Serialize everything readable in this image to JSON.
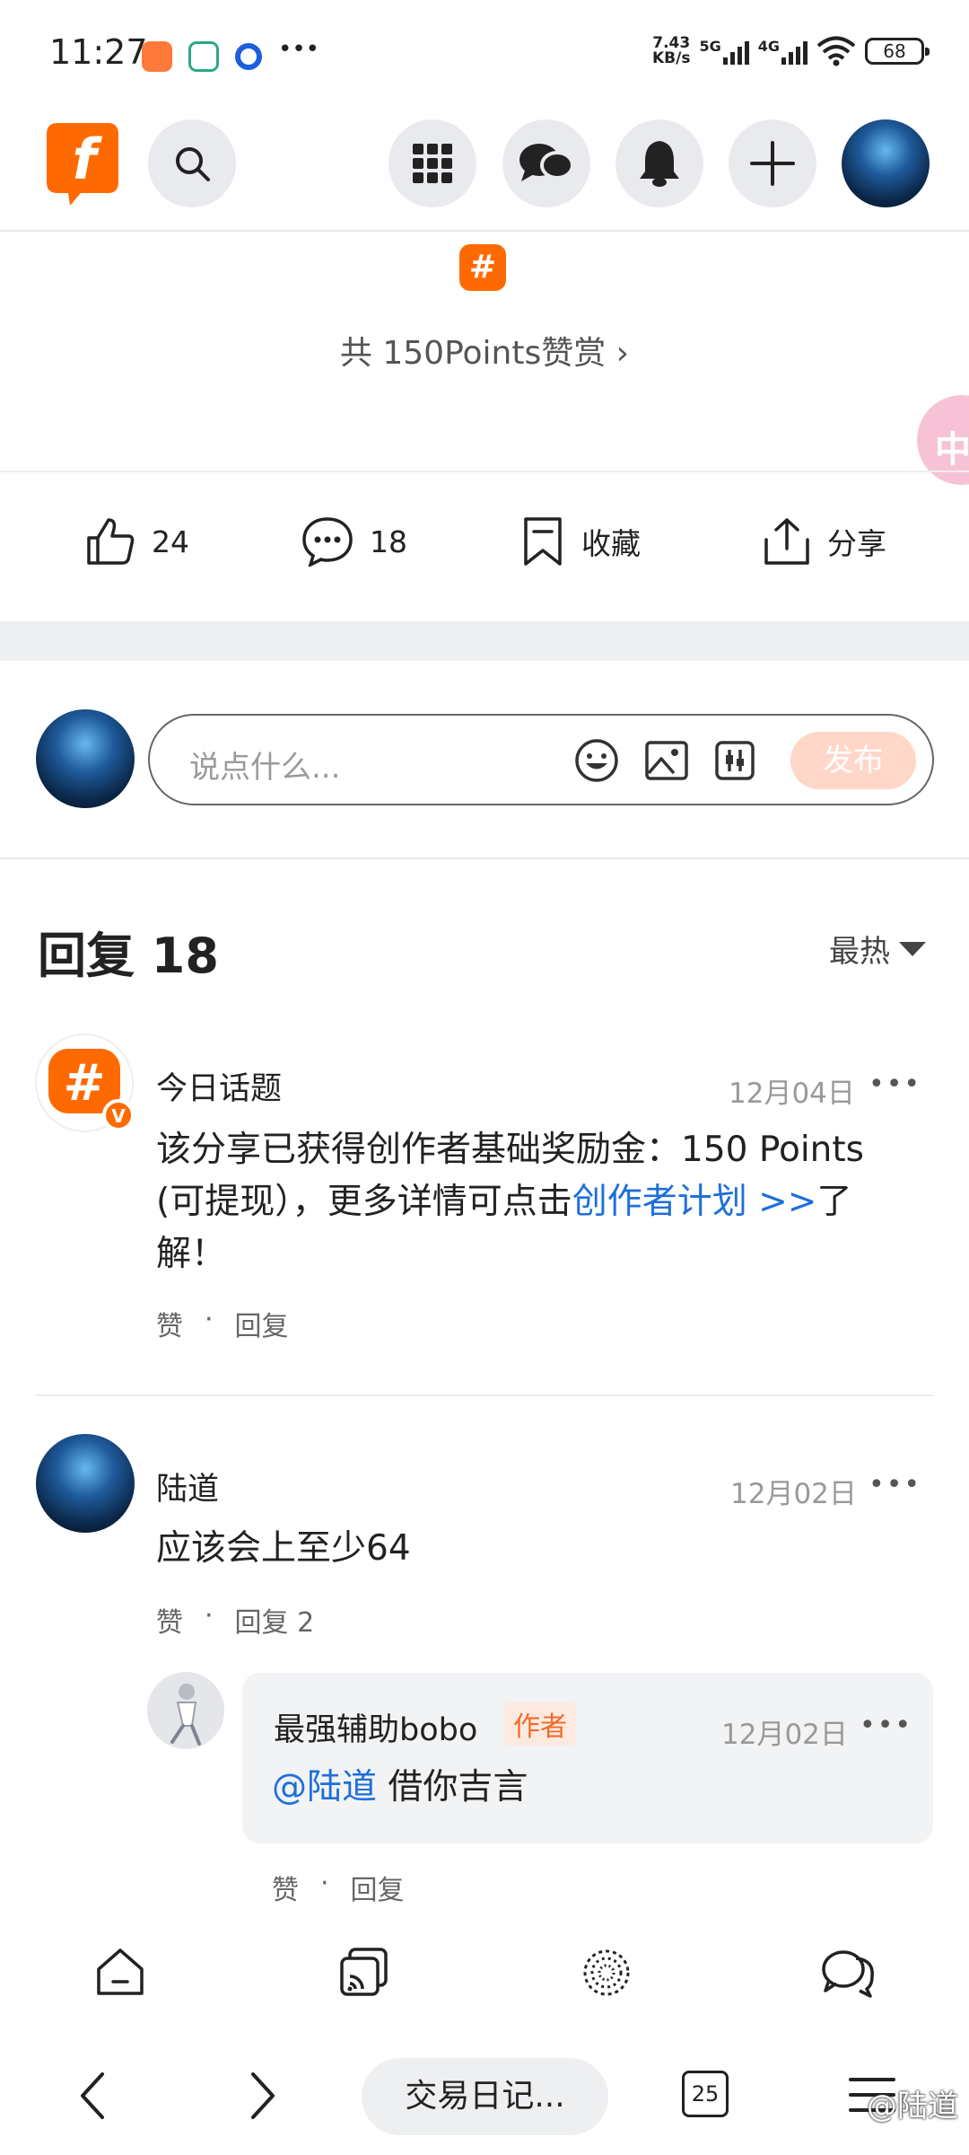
{
  "status_bar": {
    "time": "11:27",
    "speed_value": "7.43",
    "speed_unit": "KB/s",
    "sim1": "5G",
    "sim2": "4G",
    "battery": "68",
    "more": "•••"
  },
  "header": {
    "logo": "f",
    "icons": [
      "search-icon",
      "apps-grid-icon",
      "chat-icon",
      "bell-icon",
      "plus-icon"
    ]
  },
  "reward": {
    "hash": "#",
    "text": "共 150Points赞赏 ›"
  },
  "side_badge": "中",
  "actions": {
    "likes": "24",
    "comments": "18",
    "favorite": "收藏",
    "share": "分享"
  },
  "comment_input": {
    "placeholder": "说点什么...",
    "publish": "发布"
  },
  "replies": {
    "title": "回复 18",
    "sort": "最热"
  },
  "comments": [
    {
      "name": "今日话题",
      "date": "12月04日",
      "more": "•••",
      "text_line1": "该分享已获得创作者基础奖励金：150 Points",
      "text_line2_pre": "(可提现），更多详情可点击",
      "text_line2_link": "创作者计划 >>",
      "text_line2_post": "了",
      "text_line3": "解！",
      "like": "赞",
      "dot": "·",
      "reply": "回复"
    },
    {
      "name": "陆道",
      "date": "12月02日",
      "more": "•••",
      "text": "应该会上至少64",
      "like": "赞",
      "dot": "·",
      "reply": "回复 2"
    }
  ],
  "subreply": {
    "name": "最强辅助bobo",
    "tag": "作者",
    "date": "12月02日",
    "more": "•••",
    "mention": "@陆道",
    "text": " 借你吉言",
    "like": "赞",
    "dot": "·",
    "reply": "回复"
  },
  "browser": {
    "tab_title": "交易日记...",
    "tab_count": "25",
    "watermark": "@陆道"
  }
}
